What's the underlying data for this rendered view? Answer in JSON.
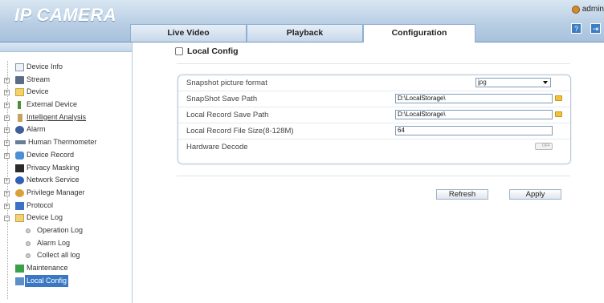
{
  "app": {
    "logo": "IP CAMERA"
  },
  "header": {
    "tabs": [
      {
        "label": "Live Video"
      },
      {
        "label": "Playback"
      },
      {
        "label": "Configuration"
      }
    ],
    "user": "admin"
  },
  "sidebar": {
    "items": [
      {
        "label": "Device Info",
        "expandable": false
      },
      {
        "label": "Stream",
        "expandable": true
      },
      {
        "label": "Device",
        "expandable": true
      },
      {
        "label": "External Device",
        "expandable": true
      },
      {
        "label": "Intelligent Analysis",
        "expandable": true
      },
      {
        "label": "Alarm",
        "expandable": true
      },
      {
        "label": "Human Thermometer",
        "expandable": true
      },
      {
        "label": "Device Record",
        "expandable": true
      },
      {
        "label": "Privacy Masking",
        "expandable": false
      },
      {
        "label": "Network Service",
        "expandable": true
      },
      {
        "label": "Privilege Manager",
        "expandable": true
      },
      {
        "label": "Protocol",
        "expandable": true
      },
      {
        "label": "Device Log",
        "expandable": true,
        "expanded": true
      },
      {
        "label": "Operation Log",
        "sub": true
      },
      {
        "label": "Alarm Log",
        "sub": true
      },
      {
        "label": "Collect all log",
        "sub": true
      },
      {
        "label": "Maintenance",
        "expandable": false
      },
      {
        "label": "Local Config",
        "expandable": false,
        "selected": true
      }
    ]
  },
  "main": {
    "title": "Local Config",
    "rows": [
      {
        "label": "Snapshot picture format",
        "value": "jpg"
      },
      {
        "label": "SnapShot Save Path",
        "value": "D:\\LocalStorage\\"
      },
      {
        "label": "Local Record Save Path",
        "value": "D:\\LocalStorage\\"
      },
      {
        "label": "Local Record File Size(8-128M)",
        "value": "64"
      },
      {
        "label": "Hardware Decode",
        "toggle": "OFF"
      }
    ],
    "buttons": {
      "refresh": "Refresh",
      "apply": "Apply"
    }
  },
  "colors": {
    "header": "#b7cde3",
    "selected": "#3b78c4",
    "folder": "#f2c23c"
  }
}
